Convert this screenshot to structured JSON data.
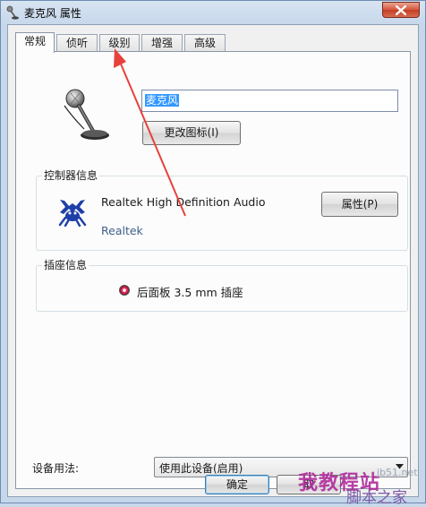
{
  "window": {
    "title": "麦克风 属性",
    "close_icon": "close-icon",
    "title_icon": "microphone-icon"
  },
  "tabs": [
    {
      "label": "常规",
      "active": true
    },
    {
      "label": "侦听",
      "active": false
    },
    {
      "label": "级别",
      "active": false
    },
    {
      "label": "增强",
      "active": false
    },
    {
      "label": "高级",
      "active": false
    }
  ],
  "general": {
    "device_icon": "microphone-icon",
    "device_name": "麦克风",
    "change_icon_label": "更改图标(I)"
  },
  "controller": {
    "legend": "控制器信息",
    "icon": "realtek-crab-icon",
    "name": "Realtek High Definition Audio",
    "vendor": "Realtek",
    "properties_label": "属性(P)"
  },
  "jack": {
    "legend": "插座信息",
    "jack_color": "#e02a5a",
    "label": "后面板 3.5 mm 插座"
  },
  "usage": {
    "label": "设备用法:",
    "selected": "使用此设备(启用)"
  },
  "buttons": {
    "ok": "确定",
    "cancel": "取"
  },
  "annotation": {
    "arrow_color": "#e8413c"
  },
  "watermark": {
    "site": "jb51.net",
    "main": "我教程站",
    "sub": "脚本之家"
  }
}
